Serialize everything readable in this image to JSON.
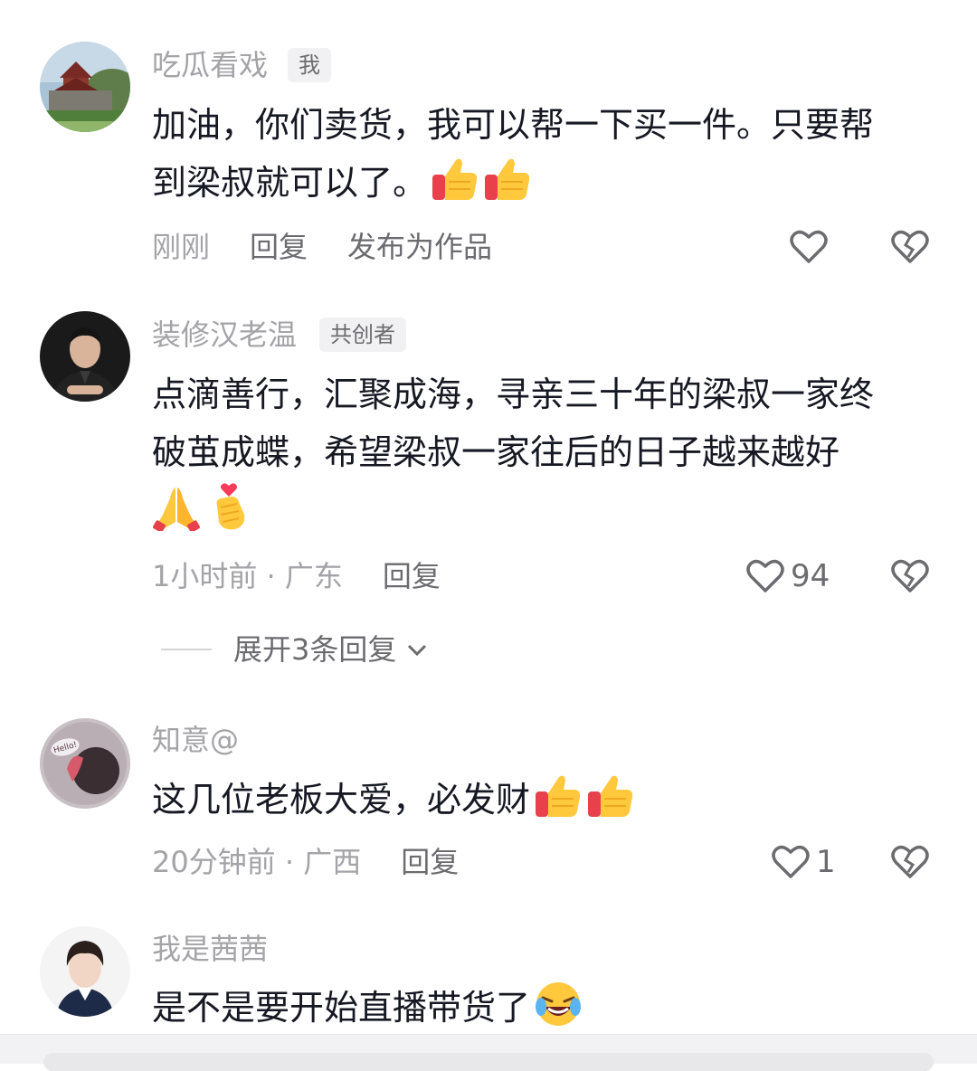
{
  "comments": [
    {
      "username": "吃瓜看戏",
      "tag": "我",
      "lines": [
        "加油，你们卖货，我可以帮一下买一件。只要帮",
        "到梁叔就可以了。"
      ],
      "emojis": [
        "thumbs-up-icon",
        "thumbs-up-icon"
      ],
      "time": "刚刚",
      "reply": "回复",
      "extra": "发布为作品",
      "likes": ""
    },
    {
      "username": "装修汉老温",
      "tag": "共创者",
      "lines": [
        "点滴善行，汇聚成海，寻亲三十年的梁叔一家终",
        "破茧成蝶，希望梁叔一家往后的日子越来越好"
      ],
      "emojis": [
        "praying-hands-icon",
        "finger-heart-icon"
      ],
      "time": "1小时前 · 广东",
      "reply": "回复",
      "likes": "94"
    },
    {
      "username": "知意@",
      "lines": [
        "这几位老板大爱，必发财"
      ],
      "emojis": [
        "thumbs-up-icon",
        "thumbs-up-icon"
      ],
      "time": "20分钟前 · 广西",
      "reply": "回复",
      "likes": "1"
    },
    {
      "username": "我是茜茜",
      "lines": [
        "是不是要开始直播带货了"
      ],
      "emojis": [
        "laughing-crying-icon"
      ]
    }
  ],
  "expand_replies": "展开3条回复",
  "colors": {
    "text_primary": "#161823",
    "text_secondary": "#a3a3a8",
    "thumbs_up": "#ffc83d",
    "cuff": "#e8414b"
  }
}
